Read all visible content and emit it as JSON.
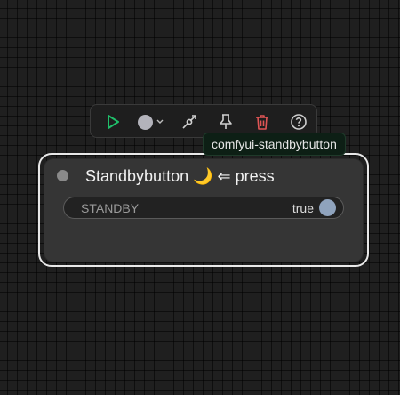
{
  "toolbar": {
    "run_icon": "play-icon",
    "color_icon": "color-picker-icon",
    "color_value": "#b3b3bb",
    "chevron_icon": "chevron-down-icon",
    "bypass_icon": "bypass-icon",
    "pin_icon": "pin-icon",
    "delete_icon": "trash-icon",
    "help_icon": "help-icon",
    "colors": {
      "run": "#1fbf6a",
      "delete": "#e05555",
      "default": "#cfcfcf"
    }
  },
  "badge": {
    "text": "comfyui-standbybutton"
  },
  "node": {
    "title": "Standbybutton 🌙 ⇐ press",
    "widget": {
      "label": "STANDBY",
      "value": "true",
      "knob_color": "#8fa3bd"
    }
  }
}
